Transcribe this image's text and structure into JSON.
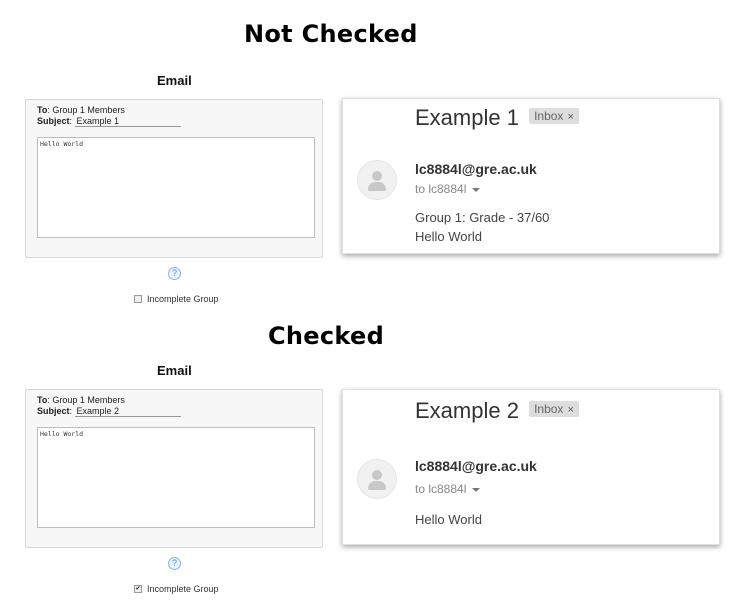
{
  "sections": [
    {
      "title": "Not Checked",
      "email_label": "Email",
      "compose": {
        "to_label": "To",
        "to_value": "Group 1 Members",
        "subject_label": "Subject",
        "subject_value": "Example 1",
        "body": "Hello World",
        "help_icon": "?",
        "checkbox_label": "Incomplete Group",
        "checkbox_checked": false
      },
      "mail": {
        "subject": "Example 1",
        "badge": "Inbox",
        "badge_close": "×",
        "sender": "lc8884l@gre.ac.uk",
        "recipient": "to lc8884l",
        "lines": [
          "Group 1: Grade - 37/60",
          "Hello World"
        ]
      }
    },
    {
      "title": "Checked",
      "email_label": "Email",
      "compose": {
        "to_label": "To",
        "to_value": "Group 1 Members",
        "subject_label": "Subject",
        "subject_value": "Example 2",
        "body": "Hello World",
        "help_icon": "?",
        "checkbox_label": "Incomplete Group",
        "checkbox_checked": true,
        "checkbox_mark": "✔"
      },
      "mail": {
        "subject": "Example 2",
        "badge": "Inbox",
        "badge_close": "×",
        "sender": "lc8884l@gre.ac.uk",
        "recipient": "to lc8884l",
        "lines": [
          "Hello World"
        ]
      }
    }
  ]
}
